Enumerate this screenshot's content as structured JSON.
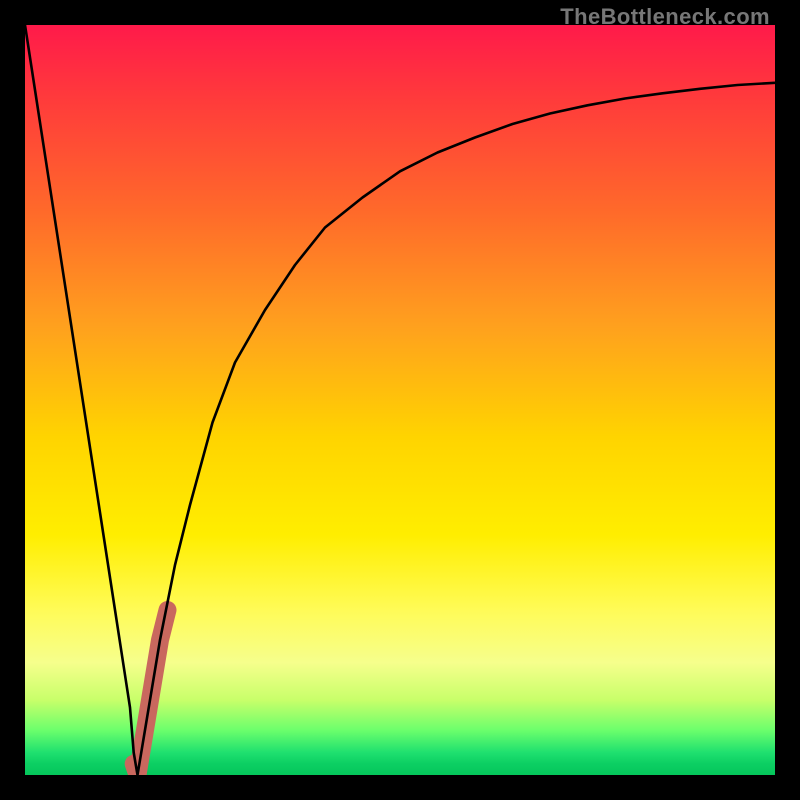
{
  "watermark": "TheBottleneck.com",
  "chart_data": {
    "type": "line",
    "title": "",
    "xlabel": "",
    "ylabel": "",
    "ylim": [
      0,
      100
    ],
    "xlim": [
      0,
      100
    ],
    "series": [
      {
        "name": "bottleneck-curve",
        "x": [
          0,
          2,
          4,
          6,
          8,
          10,
          12,
          14,
          14.5,
          15,
          16,
          17,
          18,
          20,
          22,
          25,
          28,
          32,
          36,
          40,
          45,
          50,
          55,
          60,
          65,
          70,
          75,
          80,
          85,
          90,
          95,
          100
        ],
        "values": [
          100,
          87,
          74,
          61,
          48,
          35,
          22,
          9,
          3,
          0,
          6,
          12,
          18,
          28,
          36,
          47,
          55,
          62,
          68,
          73,
          77,
          80.5,
          83,
          85,
          86.8,
          88.2,
          89.3,
          90.2,
          90.9,
          91.5,
          92,
          92.3
        ]
      },
      {
        "name": "highlight-segment",
        "x": [
          14.5,
          15,
          16,
          17,
          18,
          19
        ],
        "values": [
          1.5,
          0,
          6,
          12,
          18,
          22
        ]
      }
    ],
    "background_gradient": {
      "top": "#ff1a4a",
      "mid": "#ffee00",
      "bottom": "#05c65b"
    }
  }
}
